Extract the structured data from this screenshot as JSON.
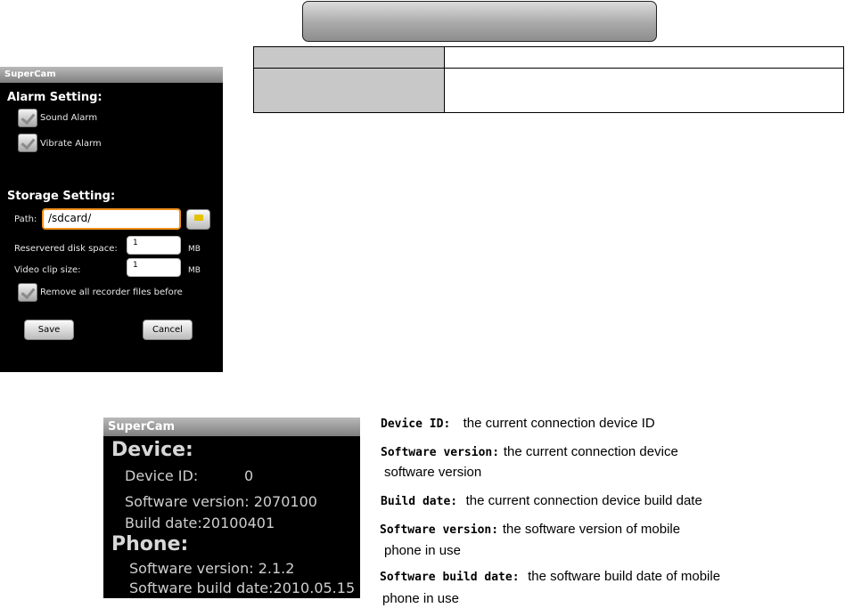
{
  "settings_screen": {
    "title": "SuperCam",
    "alarm_heading": "Alarm Setting:",
    "sound_alarm": "Sound Alarm",
    "vibrate_alarm": "Vibrate Alarm",
    "storage_heading": "Storage Setting:",
    "path_label": "Path:",
    "path_value": "/sdcard/",
    "reserved_label": "Reservered disk space:",
    "reserved_value": "1",
    "reserved_unit": "MB",
    "clip_label": "Video clip size:",
    "clip_value": "1",
    "clip_unit": "MB",
    "remove_files": "Remove all recorder files before",
    "save_label": "Save",
    "cancel_label": "Cancel"
  },
  "about_screen": {
    "title": "SuperCam",
    "device_heading": "Device:",
    "device_id_label": "Device ID:",
    "device_id_value": "0",
    "software_version": "Software version: 2070100",
    "build_date": "Build date:20100401",
    "phone_heading": "Phone:",
    "phone_software_version": "Software version:   2.1.2",
    "phone_build_date": "Software build date:2010.05.15"
  },
  "descriptions": [
    {
      "key": "Device ID:",
      "line1": "the current connection device ID",
      "line2": ""
    },
    {
      "key": "Software version:",
      "line1": "the current connection device",
      "line2": "software version"
    },
    {
      "key": "Build date:",
      "line1": "the current connection device build date",
      "line2": ""
    },
    {
      "key": "Software version:",
      "line1": "the  software version of mobile",
      "line2": "phone in use"
    },
    {
      "key": "Software build date:",
      "line1": "the software build date of  mobile",
      "line2": "phone in use"
    }
  ],
  "colors": {
    "path_focus": "#f0901c",
    "screen_bg": "#000000",
    "titlebar": "#9a9a9a"
  },
  "icons": {
    "checkbox": "checkmark-icon",
    "browse": "folder-icon"
  }
}
